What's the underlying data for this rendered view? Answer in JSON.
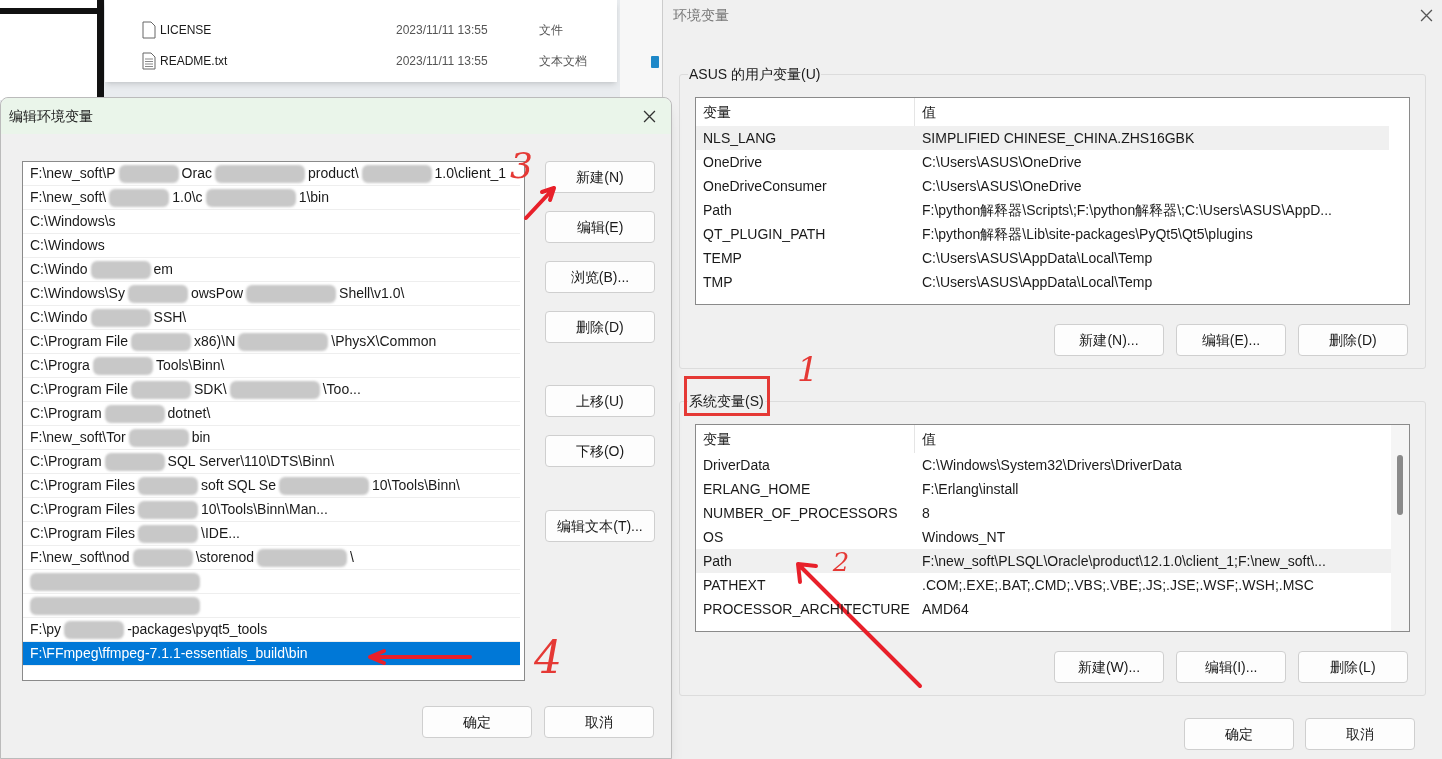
{
  "explorer": {
    "rows": [
      {
        "kind": "file",
        "name": "LICENSE",
        "date": "2023/11/11 13:55",
        "type": "文件"
      },
      {
        "kind": "text",
        "name": "README.txt",
        "date": "2023/11/11 13:55",
        "type": "文本文档"
      }
    ]
  },
  "env_dialog": {
    "title": "环境变量",
    "user_group": {
      "label": "ASUS 的用户变量(U)",
      "columns": [
        "变量",
        "值"
      ],
      "rows": [
        {
          "name": "NLS_LANG",
          "value": "SIMPLIFIED CHINESE_CHINA.ZHS16GBK",
          "selected": true
        },
        {
          "name": "OneDrive",
          "value": "C:\\Users\\ASUS\\OneDrive",
          "selected": false
        },
        {
          "name": "OneDriveConsumer",
          "value": "C:\\Users\\ASUS\\OneDrive",
          "selected": false
        },
        {
          "name": "Path",
          "value": "F:\\python解释器\\Scripts\\;F:\\python解释器\\;C:\\Users\\ASUS\\AppD...",
          "selected": false
        },
        {
          "name": "QT_PLUGIN_PATH",
          "value": "F:\\python解释器\\Lib\\site-packages\\PyQt5\\Qt5\\plugins",
          "selected": false
        },
        {
          "name": "TEMP",
          "value": "C:\\Users\\ASUS\\AppData\\Local\\Temp",
          "selected": false
        },
        {
          "name": "TMP",
          "value": "C:\\Users\\ASUS\\AppData\\Local\\Temp",
          "selected": false
        }
      ],
      "buttons": [
        "新建(N)...",
        "编辑(E)...",
        "删除(D)"
      ]
    },
    "system_group": {
      "label": "系统变量(S)",
      "columns": [
        "变量",
        "值"
      ],
      "rows": [
        {
          "name": "DriverData",
          "value": "C:\\Windows\\System32\\Drivers\\DriverData",
          "selected": false
        },
        {
          "name": "ERLANG_HOME",
          "value": "F:\\Erlang\\install",
          "selected": false
        },
        {
          "name": "NUMBER_OF_PROCESSORS",
          "value": "8",
          "selected": false
        },
        {
          "name": "OS",
          "value": "Windows_NT",
          "selected": false
        },
        {
          "name": "Path",
          "value": "F:\\new_soft\\PLSQL\\Oracle\\product\\12.1.0\\client_1;F:\\new_soft\\...",
          "selected": true
        },
        {
          "name": "PATHEXT",
          "value": ".COM;.EXE;.BAT;.CMD;.VBS;.VBE;.JS;.JSE;.WSF;.WSH;.MSC",
          "selected": false
        },
        {
          "name": "PROCESSOR_ARCHITECTURE",
          "value": "AMD64",
          "selected": false
        }
      ],
      "buttons": [
        "新建(W)...",
        "编辑(I)...",
        "删除(L)"
      ]
    },
    "buttons": [
      "确定",
      "取消"
    ]
  },
  "edit_dialog": {
    "title": "编辑环境变量",
    "items": [
      {
        "kind": "path",
        "parts": [
          "F:\\new_soft\\P",
          "Orac",
          "product\\",
          "1.0\\client_1"
        ],
        "selected": false
      },
      {
        "kind": "path",
        "parts": [
          "F:\\new_soft\\",
          "1.0\\c",
          "1\\bin"
        ],
        "selected": false
      },
      {
        "kind": "path",
        "parts": [
          "C:\\Windows\\s"
        ],
        "selected": false
      },
      {
        "kind": "path",
        "parts": [
          "C:\\Windows"
        ],
        "selected": false
      },
      {
        "kind": "path",
        "parts": [
          "C:\\Windo",
          "em"
        ],
        "selected": false
      },
      {
        "kind": "path",
        "parts": [
          "C:\\Windows\\Sy",
          "owsPow",
          "Shell\\v1.0\\"
        ],
        "selected": false
      },
      {
        "kind": "path",
        "parts": [
          "C:\\Windo",
          "SSH\\"
        ],
        "selected": false
      },
      {
        "kind": "path",
        "parts": [
          "C:\\Program File",
          "x86)\\N",
          "\\PhysX\\Common"
        ],
        "selected": false
      },
      {
        "kind": "path",
        "parts": [
          "C:\\Progra",
          "Tools\\Binn\\"
        ],
        "selected": false
      },
      {
        "kind": "path",
        "parts": [
          "C:\\Program File",
          "SDK\\",
          "\\Too..."
        ],
        "selected": false
      },
      {
        "kind": "path",
        "parts": [
          "C:\\Program",
          "dotnet\\"
        ],
        "selected": false
      },
      {
        "kind": "path",
        "parts": [
          "F:\\new_soft\\Tor",
          "bin"
        ],
        "selected": false
      },
      {
        "kind": "path",
        "parts": [
          "C:\\Program",
          "SQL Server\\110\\DTS\\Binn\\"
        ],
        "selected": false
      },
      {
        "kind": "path",
        "parts": [
          "C:\\Program Files",
          "soft SQL Se",
          "10\\Tools\\Binn\\"
        ],
        "selected": false
      },
      {
        "kind": "path",
        "parts": [
          "C:\\Program Files",
          "10\\Tools\\Binn\\Man..."
        ],
        "selected": false
      },
      {
        "kind": "path",
        "parts": [
          "C:\\Program Files",
          "\\IDE..."
        ],
        "selected": false
      },
      {
        "kind": "path",
        "parts": [
          "F:\\new_soft\\nod",
          "\\storenod",
          "\\"
        ],
        "selected": false
      },
      {
        "kind": "redacted",
        "selected": false
      },
      {
        "kind": "redacted",
        "selected": false
      },
      {
        "kind": "path",
        "parts": [
          "F:\\py",
          "-packages\\pyqt5_tools"
        ],
        "selected": false
      },
      {
        "kind": "path",
        "parts": [
          "F:\\FFmpeg\\ffmpeg-7.1.1-essentials_build\\bin"
        ],
        "selected": true
      }
    ],
    "side_buttons": [
      "新建(N)",
      "编辑(E)",
      "浏览(B)...",
      "删除(D)",
      "上移(U)",
      "下移(O)",
      "编辑文本(T)..."
    ],
    "buttons": [
      "确定",
      "取消"
    ]
  },
  "annotations": [
    {
      "kind": "number",
      "text": "3"
    },
    {
      "kind": "arrow"
    },
    {
      "kind": "number",
      "text": "1"
    },
    {
      "kind": "box"
    },
    {
      "kind": "number",
      "text": "2"
    },
    {
      "kind": "arrow"
    },
    {
      "kind": "number",
      "text": "4"
    },
    {
      "kind": "arrow"
    }
  ]
}
